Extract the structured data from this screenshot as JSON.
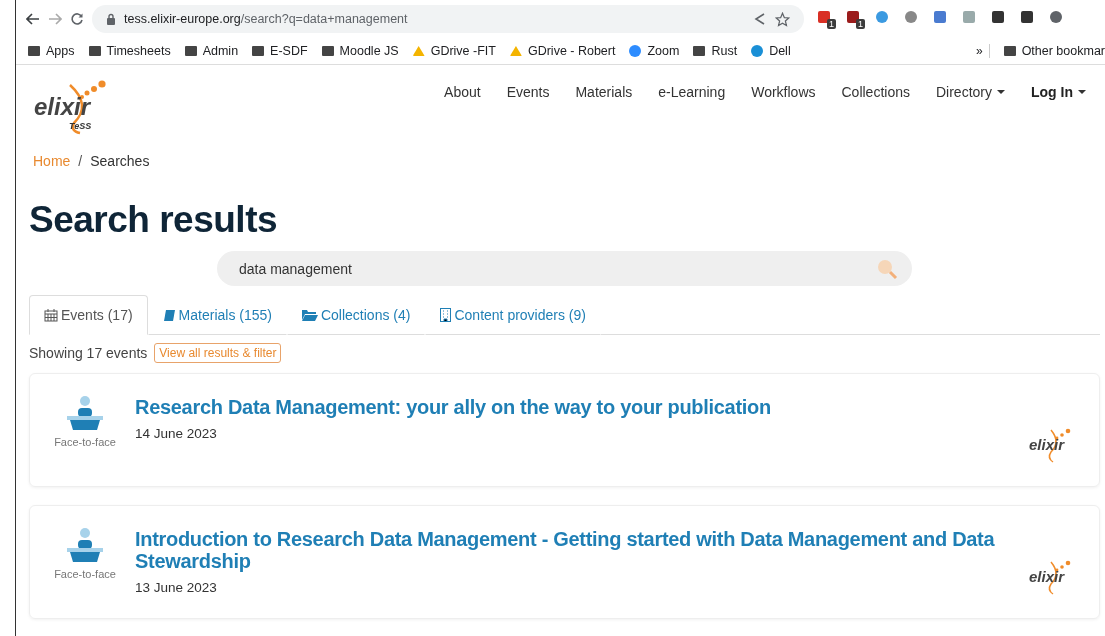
{
  "browser": {
    "url_host": "tess.elixir-europe.org",
    "url_path": "/search?q=data+management",
    "extensions": [
      {
        "kind": "red",
        "badge": "1"
      },
      {
        "kind": "shield",
        "badge": "1"
      },
      {
        "kind": "check"
      },
      {
        "kind": "gear"
      },
      {
        "kind": "feather"
      },
      {
        "kind": "people"
      },
      {
        "kind": "puzzle"
      },
      {
        "kind": "panel"
      },
      {
        "kind": "avatar"
      }
    ],
    "bookmarks": [
      {
        "kind": "folder",
        "label": "Apps"
      },
      {
        "kind": "folder",
        "label": "Timesheets"
      },
      {
        "kind": "folder",
        "label": "Admin"
      },
      {
        "kind": "folder",
        "label": "E-SDF"
      },
      {
        "kind": "folder",
        "label": "Moodle JS"
      },
      {
        "kind": "drive",
        "label": "GDrive -FIT"
      },
      {
        "kind": "drive",
        "label": "GDrive - Robert"
      },
      {
        "kind": "zoom",
        "label": "Zoom"
      },
      {
        "kind": "folder",
        "label": "Rust"
      },
      {
        "kind": "dell",
        "label": "Dell"
      }
    ],
    "more": "»",
    "other_bookmarks": "Other bookmar"
  },
  "logo": {
    "word": "elixir",
    "sub": "TeSS"
  },
  "nav": [
    {
      "label": "About",
      "dropdown": false,
      "bold": false
    },
    {
      "label": "Events",
      "dropdown": false,
      "bold": false
    },
    {
      "label": "Materials",
      "dropdown": false,
      "bold": false
    },
    {
      "label": "e-Learning",
      "dropdown": false,
      "bold": false
    },
    {
      "label": "Workflows",
      "dropdown": false,
      "bold": false
    },
    {
      "label": "Collections",
      "dropdown": false,
      "bold": false
    },
    {
      "label": "Directory",
      "dropdown": true,
      "bold": false
    },
    {
      "label": "Log In",
      "dropdown": true,
      "bold": true
    }
  ],
  "breadcrumb": {
    "home": "Home",
    "separator": "/",
    "current": "Searches"
  },
  "heading": "Search results",
  "search": {
    "value": "data management"
  },
  "tabs": [
    {
      "kind": "calendar",
      "label": "Events (17)",
      "selected": true
    },
    {
      "kind": "book",
      "label": "Materials (155)",
      "selected": false
    },
    {
      "kind": "folder",
      "label": "Collections (4)",
      "selected": false
    },
    {
      "kind": "building",
      "label": "Content providers (9)",
      "selected": false
    }
  ],
  "summary": "Showing 17 events",
  "filter_button": "View all results & filter",
  "results": [
    {
      "format": "Face-to-face",
      "title": "Research Data Management: your ally on the way to your publication",
      "date": "14 June 2023",
      "provider": "elixir"
    },
    {
      "format": "Face-to-face",
      "title": "Introduction to Research Data Management - Getting started with Data Management and Data Stewardship",
      "date": "13 June 2023",
      "provider": "elixir"
    }
  ]
}
